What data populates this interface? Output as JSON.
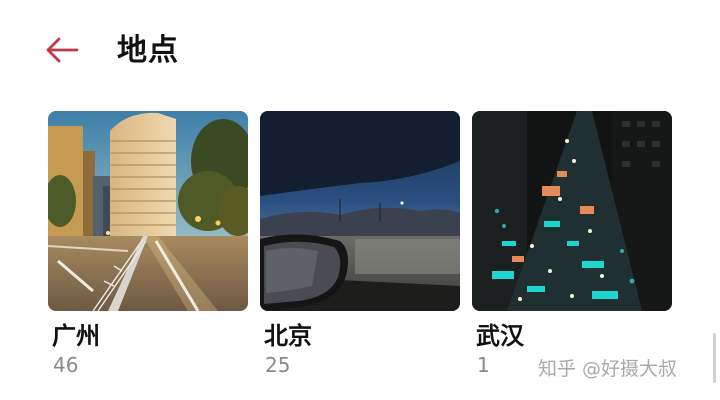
{
  "header": {
    "title": "地点",
    "back_icon": "arrow-left-icon",
    "accent_color": "#c0394a"
  },
  "albums": [
    {
      "name": "广州",
      "count": "46",
      "photo": "city-street-at-dusk"
    },
    {
      "name": "北京",
      "count": "25",
      "photo": "car-mirror-evening-sky"
    },
    {
      "name": "武汉",
      "count": "1",
      "photo": "night-market-aerial"
    }
  ],
  "watermark": "知乎 @好摄大叔"
}
